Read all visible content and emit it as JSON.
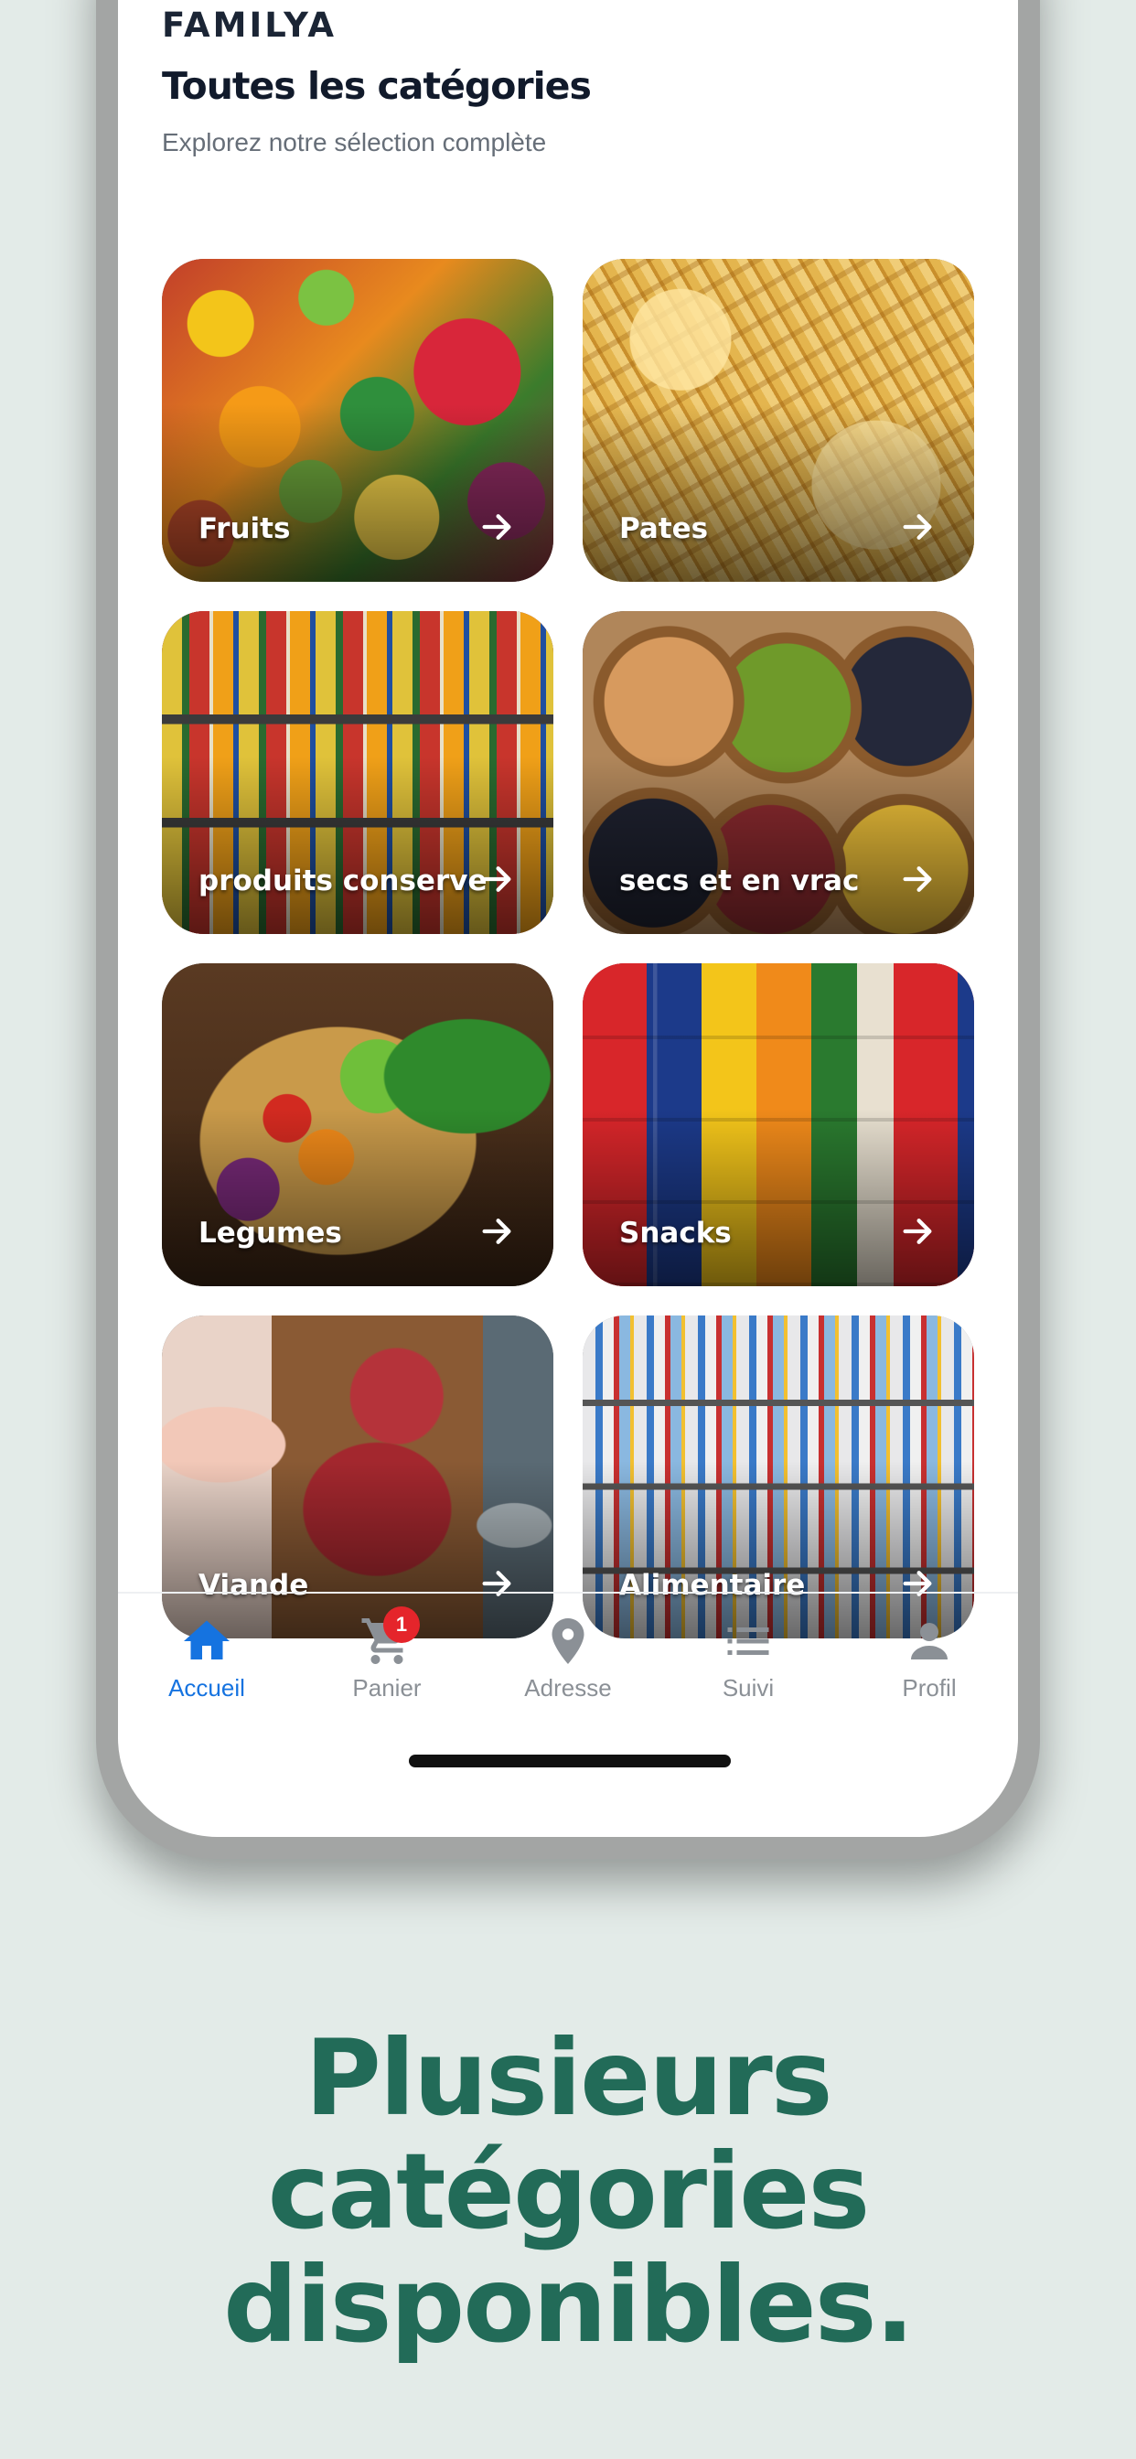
{
  "app": {
    "brand": "FAMILYA"
  },
  "header": {
    "title": "Toutes les catégories",
    "subtitle": "Explorez notre sélection complète"
  },
  "categories": [
    {
      "label": "Fruits"
    },
    {
      "label": "Pates"
    },
    {
      "label": "produits conserve"
    },
    {
      "label": "secs et en vrac"
    },
    {
      "label": "Legumes"
    },
    {
      "label": "Snacks"
    },
    {
      "label": "Viande"
    },
    {
      "label": "Alimentaire"
    }
  ],
  "nav": {
    "items": [
      {
        "label": "Accueil",
        "icon": "home-icon",
        "active": true
      },
      {
        "label": "Panier",
        "icon": "cart-icon",
        "badge": "1"
      },
      {
        "label": "Adresse",
        "icon": "location-pin-icon"
      },
      {
        "label": "Suivi",
        "icon": "list-icon"
      },
      {
        "label": "Profil",
        "icon": "user-icon"
      }
    ]
  },
  "tagline": {
    "line1": "Plusieurs",
    "line2": "catégories",
    "line3": "disponibles."
  },
  "colors": {
    "background": "#e3ebe8",
    "accent": "#1573e0",
    "tagline": "#226b58",
    "badge": "#e5252b"
  }
}
